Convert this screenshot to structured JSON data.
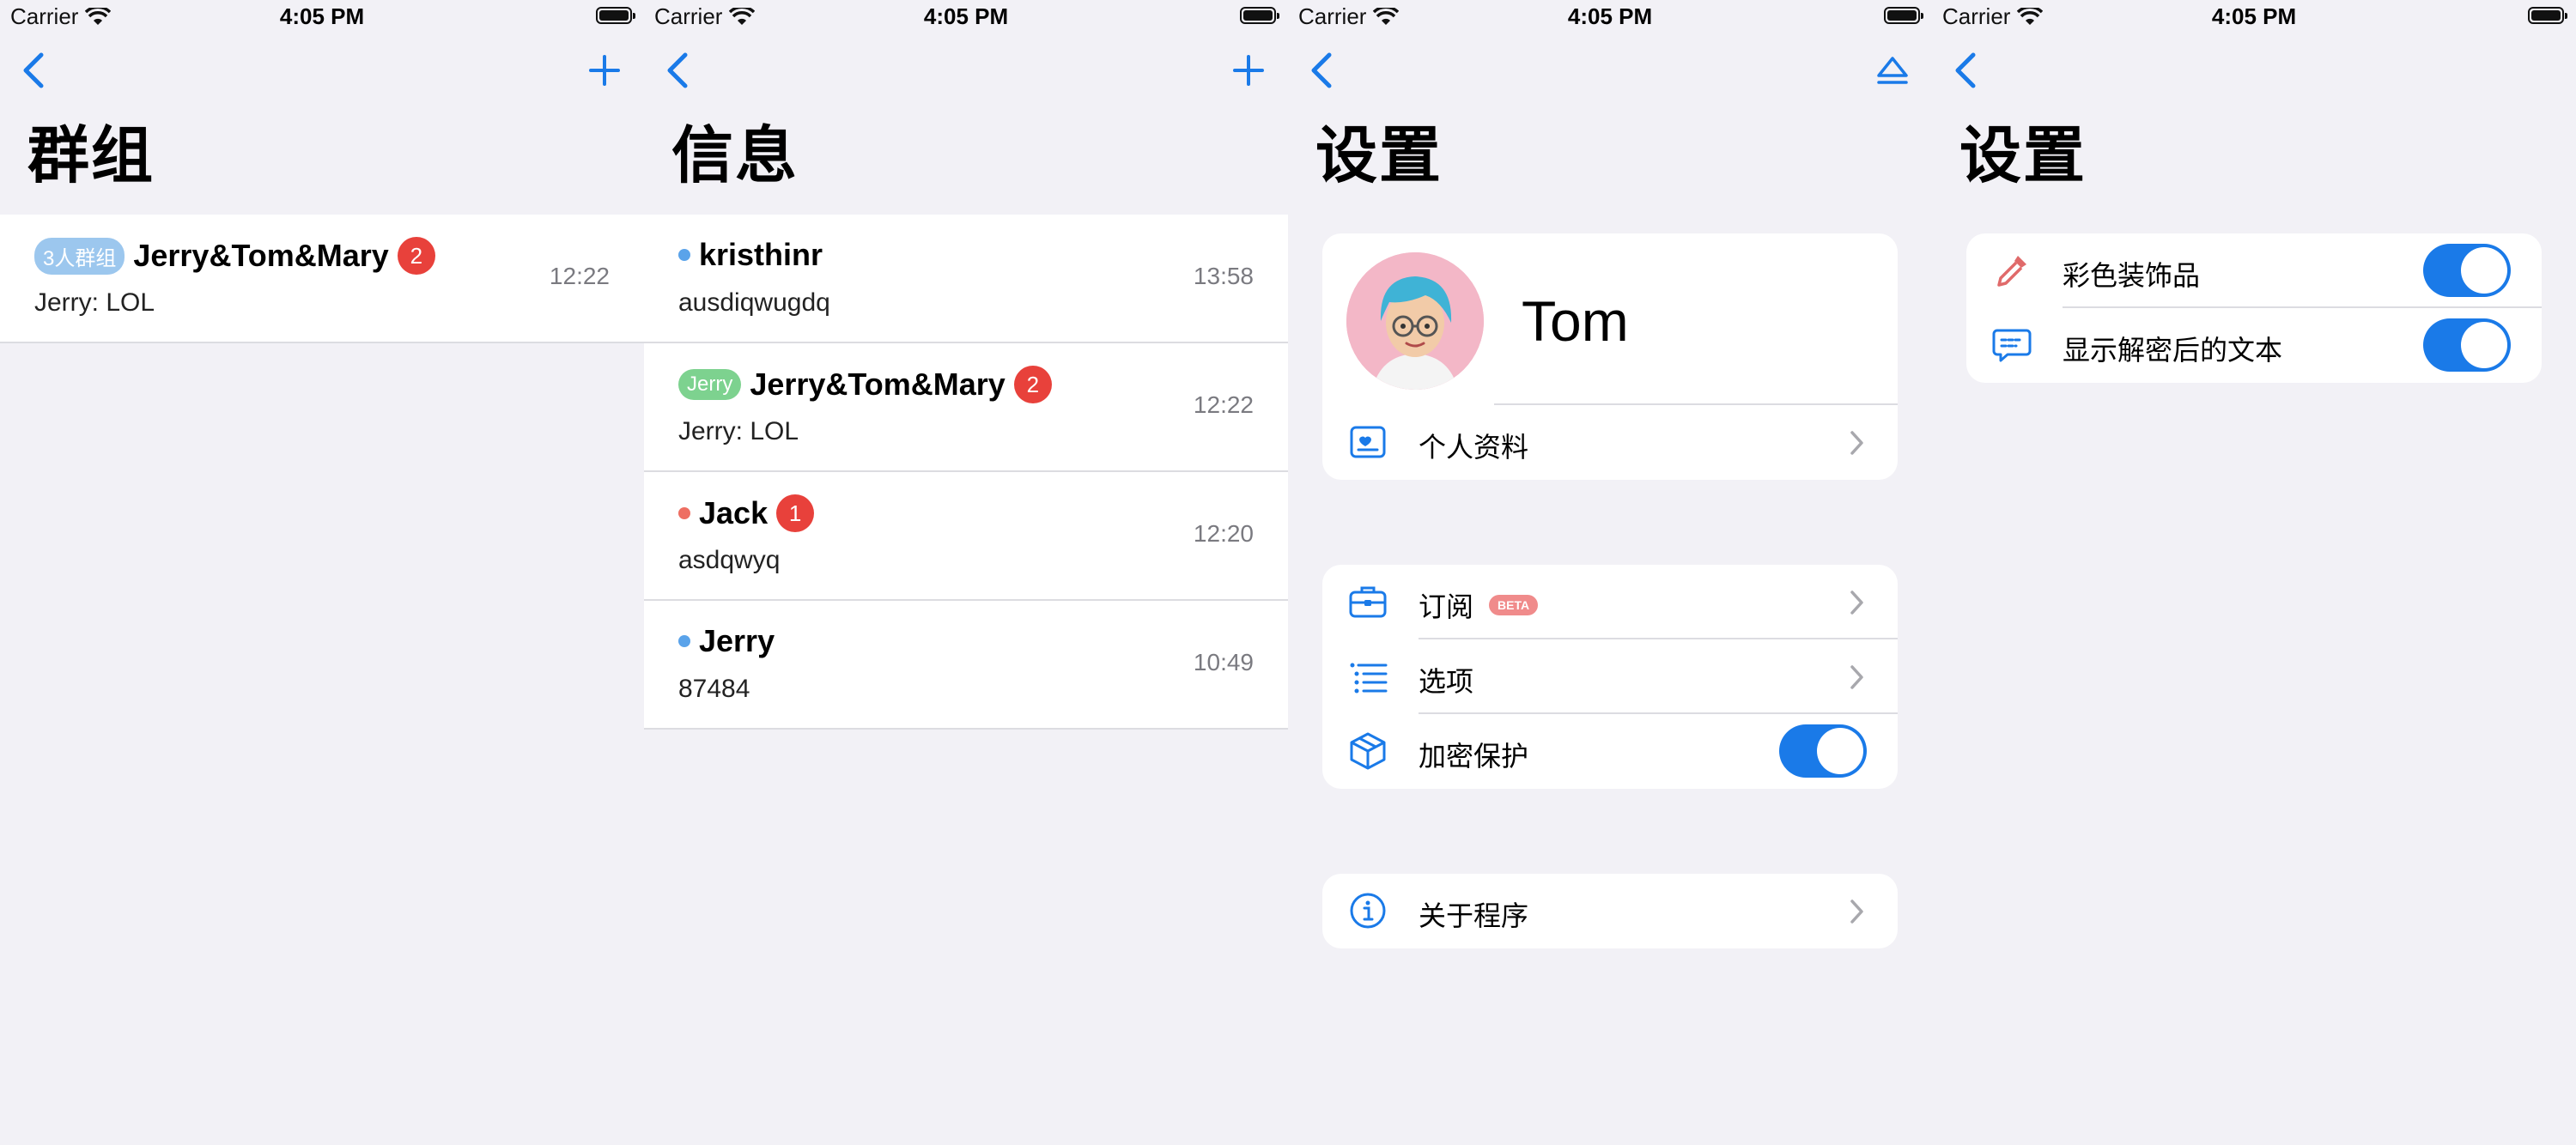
{
  "status": {
    "carrier": "Carrier",
    "time": "4:05 PM"
  },
  "colors": {
    "accent": "#1a7ae8",
    "badge": "#e8413b",
    "dot_blue": "#5aa3ea",
    "dot_red": "#ee6e62",
    "tag_blue": "#9cc7ee",
    "tag_green": "#7dd28f"
  },
  "screen1": {
    "title": "群组",
    "row": {
      "tag": "3人群组",
      "name": "Jerry&Tom&Mary",
      "badge": "2",
      "preview": "Jerry: LOL",
      "time": "12:22"
    }
  },
  "screen2": {
    "title": "信息",
    "rows": [
      {
        "name": "kristhinr",
        "preview": "ausdiqwugdq",
        "time": "13:58"
      },
      {
        "tag": "Jerry",
        "name": "Jerry&Tom&Mary",
        "badge": "2",
        "preview": "Jerry: LOL",
        "time": "12:22"
      },
      {
        "name": "Jack",
        "badge": "1",
        "preview": "asdqwyq",
        "time": "12:20"
      },
      {
        "name": "Jerry",
        "preview": "87484",
        "time": "10:49"
      }
    ]
  },
  "screen3": {
    "title": "设置",
    "profile_name": "Tom",
    "profile_item": "个人资料",
    "subscribe": "订阅",
    "beta": "BETA",
    "options": "选项",
    "encryption": "加密保护",
    "about": "关于程序"
  },
  "screen4": {
    "title": "设置",
    "colorful": "彩色装饰品",
    "show_decrypted": "显示解密后的文本"
  }
}
